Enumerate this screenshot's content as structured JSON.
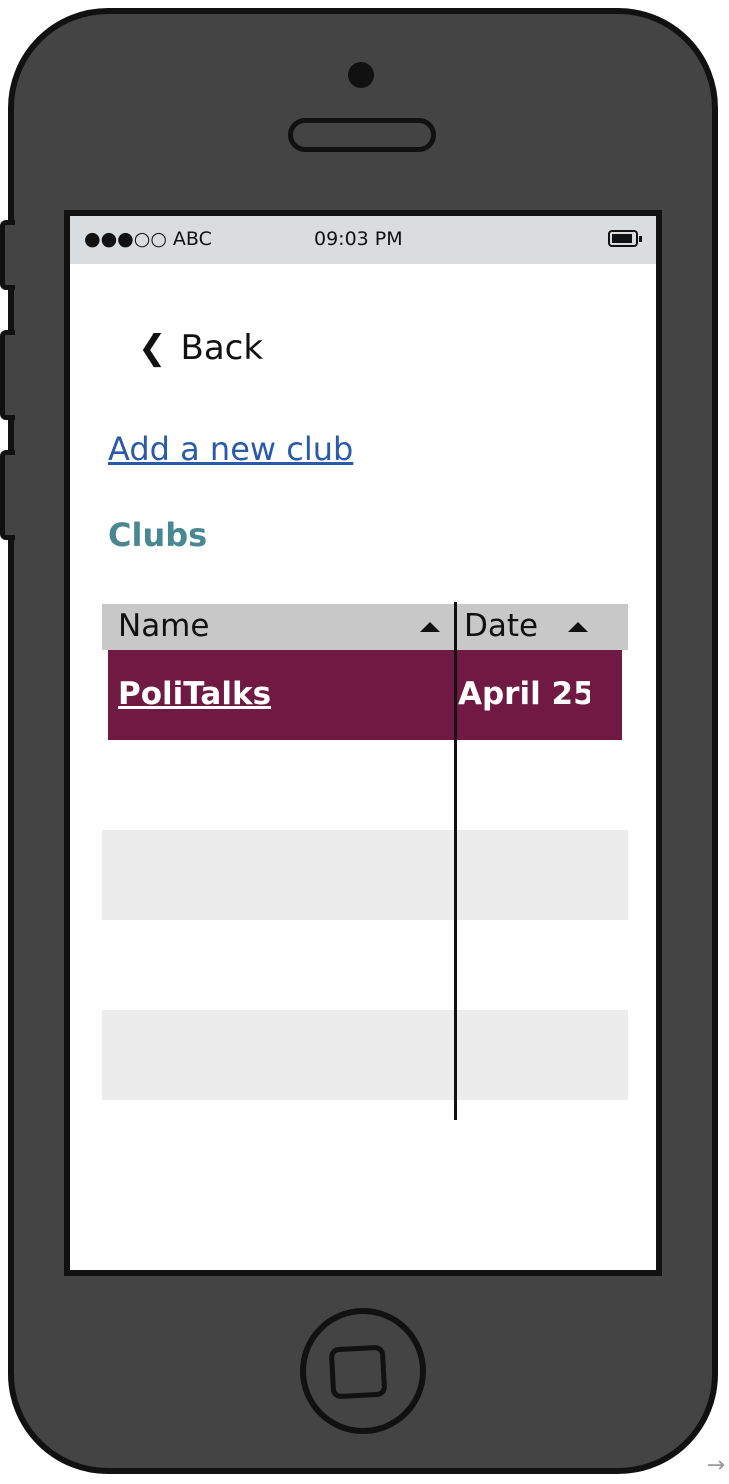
{
  "status_bar": {
    "carrier": "●●●○○ ABC",
    "time": "09:03 PM"
  },
  "nav": {
    "back_label": "Back",
    "back_icon": "chevron-left-icon"
  },
  "links": {
    "add_club": "Add a new club"
  },
  "section": {
    "title": "Clubs"
  },
  "table": {
    "columns": [
      "Name",
      "Date"
    ],
    "sort_icon": "sort-up-icon",
    "rows": [
      {
        "name": "PoliTalks",
        "date": "April 25"
      }
    ],
    "selected_row_color": "#701a43",
    "alt_row_color": "#ececec"
  },
  "colors": {
    "link": "#2b5ba8",
    "section_title": "#4a8891",
    "phone_body": "#444444",
    "status_bar": "#d9dde0"
  },
  "corner_icon": "arrow-right-icon"
}
